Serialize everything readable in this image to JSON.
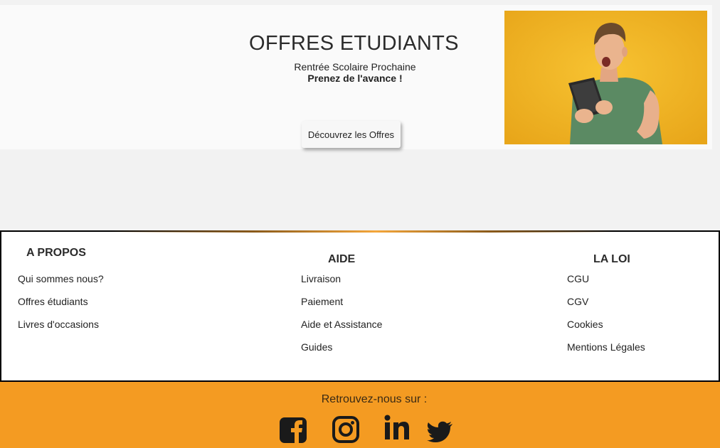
{
  "hero": {
    "title": "OFFRES ETUDIANTS",
    "subtitle": "Rentrée Scolaire Prochaine",
    "tagline": "Prenez de l'avance !",
    "cta_label": "Découvrez les Offres"
  },
  "footer": {
    "columns": [
      {
        "title": "A PROPOS",
        "links": [
          "Qui sommes nous?",
          "Offres étudiants",
          "Livres d'occasions"
        ]
      },
      {
        "title": "AIDE",
        "links": [
          "Livraison",
          "Paiement",
          "Aide et Assistance",
          "Guides"
        ]
      },
      {
        "title": "LA LOI",
        "links": [
          "CGU",
          "CGV",
          "Cookies",
          "Mentions Légales"
        ]
      }
    ]
  },
  "social": {
    "label": "Retrouvez-nous sur :",
    "icons": [
      "facebook-icon",
      "instagram-icon",
      "linkedin-icon",
      "twitter-icon"
    ]
  },
  "colors": {
    "accent": "#f49b22",
    "photo_background": "#eeb224",
    "page_background": "#f2f2f2"
  }
}
